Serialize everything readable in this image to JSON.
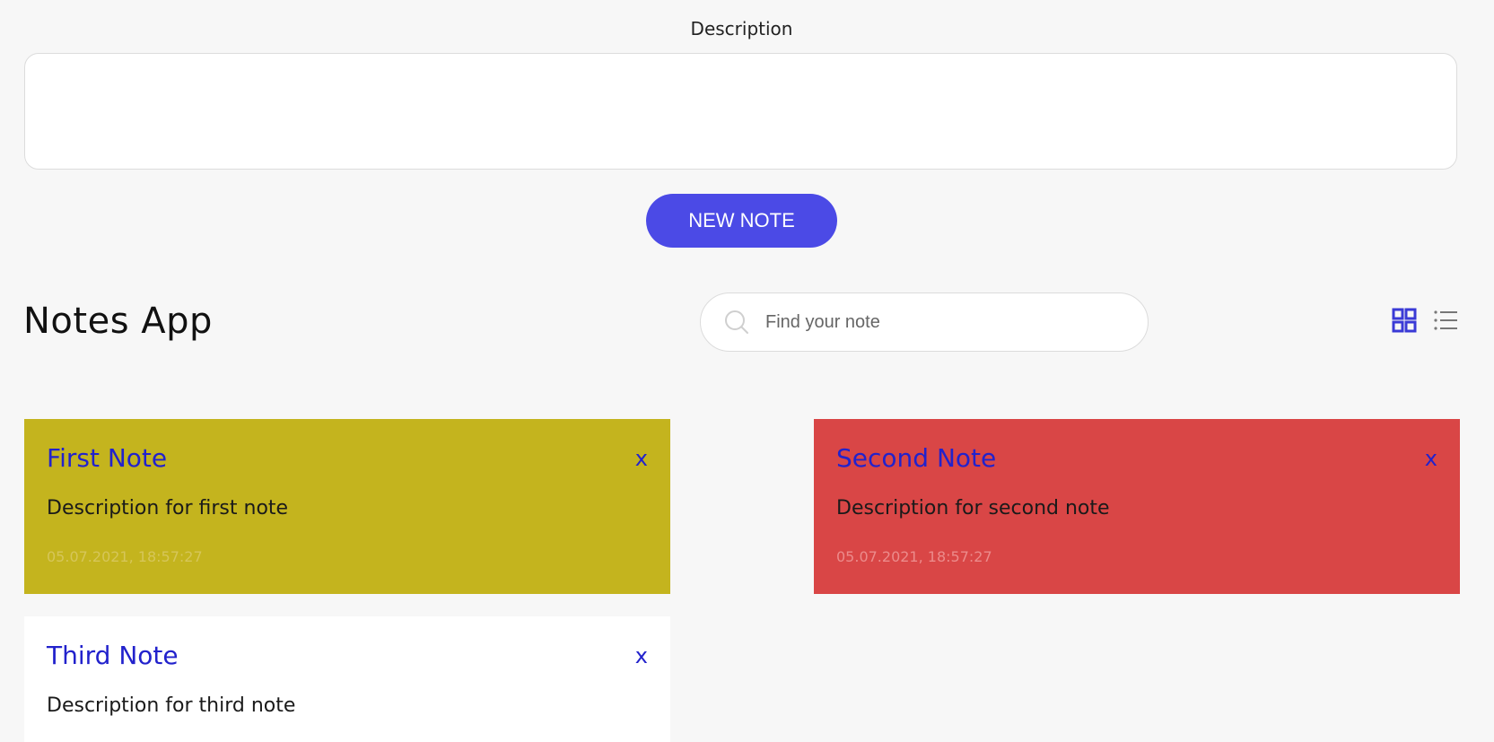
{
  "form": {
    "description_label": "Description",
    "description_value": "",
    "new_note_label": "NEW NOTE"
  },
  "header": {
    "title": "Notes App",
    "search_placeholder": "Find your note",
    "icons": [
      "search-icon",
      "grid-view-icon",
      "list-view-icon"
    ]
  },
  "colors": {
    "accent": "#4b4ae6",
    "note_yellow": "#c4b41e",
    "note_red": "#d94646",
    "note_white": "#ffffff",
    "note_title": "#2222cc"
  },
  "notes": [
    {
      "title": "First Note",
      "description": "Description for first note",
      "date": "05.07.2021, 18:57:27",
      "close_label": "x",
      "color": "#c4b41e"
    },
    {
      "title": "Second Note",
      "description": "Description for second note",
      "date": "05.07.2021, 18:57:27",
      "close_label": "x",
      "color": "#d94646"
    },
    {
      "title": "Third Note",
      "description": "Description for third note",
      "date": "",
      "close_label": "x",
      "color": "#ffffff"
    }
  ]
}
